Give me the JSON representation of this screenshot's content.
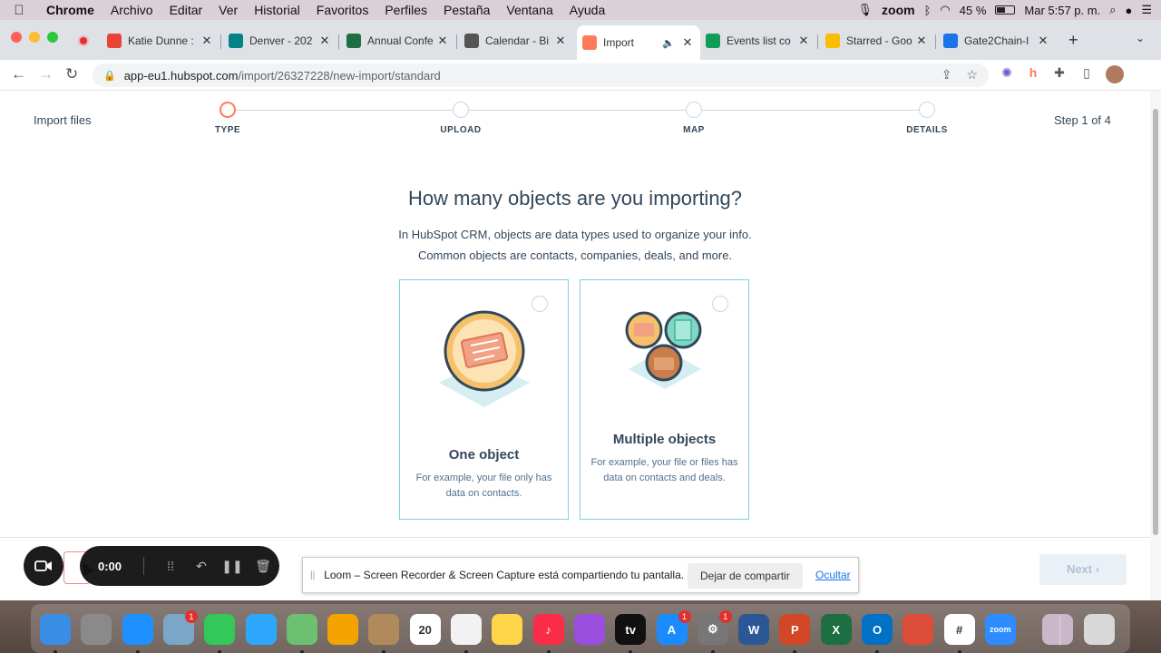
{
  "menubar": {
    "apple_icon": "",
    "items": [
      "Chrome",
      "Archivo",
      "Editar",
      "Ver",
      "Historial",
      "Favoritos",
      "Perfiles",
      "Pestaña",
      "Ventana",
      "Ayuda"
    ],
    "zoom_label": "zoom",
    "battery": "45 %",
    "clock": "Mar 5:57 p. m."
  },
  "browser": {
    "tabs": [
      {
        "title": "Katie Dunne :",
        "icon": "gmail-icon",
        "color": "#ea4335"
      },
      {
        "title": "Denver - 202",
        "icon": "sharepoint-icon",
        "color": "#038387"
      },
      {
        "title": "Annual Confe",
        "icon": "excel-icon",
        "color": "#1d6f42"
      },
      {
        "title": "Calendar - Bi",
        "icon": "calendar-icon",
        "color": "#555555"
      },
      {
        "title": "Import",
        "icon": "hubspot-icon",
        "color": "#ff7a59",
        "active": true
      },
      {
        "title": "Events list co",
        "icon": "sheets-icon",
        "color": "#0f9d58"
      },
      {
        "title": "Starred - Goo",
        "icon": "drive-icon",
        "color": "#fbbc04"
      },
      {
        "title": "Gate2Chain-I",
        "icon": "docs-icon",
        "color": "#1a73e8"
      }
    ],
    "url_host": "app-eu1.hubspot.com",
    "url_path": "/import/26327228/new-import/standard"
  },
  "page": {
    "import_label": "Import files",
    "step_indicator": "Step 1 of 4",
    "steps": [
      "TYPE",
      "UPLOAD",
      "MAP",
      "DETAILS"
    ],
    "current_step": 0,
    "question": "How many objects are you importing?",
    "description_line1": "In HubSpot CRM, objects are data types used to organize your info.",
    "description_line2": "Common objects are contacts, companies, deals, and more.",
    "options": [
      {
        "title": "One object",
        "description": "For example, your file only has data on contacts."
      },
      {
        "title": "Multiple objects",
        "description": "For example, your file or files has data on contacts and deals."
      }
    ],
    "next_label": "Next ›"
  },
  "loom": {
    "timer": "0:00",
    "share_message": "Loom – Screen Recorder & Screen Capture está compartiendo tu pantalla.",
    "stop_sharing": "Dejar de compartir",
    "hide": "Ocultar"
  },
  "dock": {
    "apps": [
      {
        "name": "finder",
        "color": "#3a8ee6",
        "label": ""
      },
      {
        "name": "launchpad",
        "color": "#8a8a8a",
        "label": ""
      },
      {
        "name": "safari",
        "color": "#1e90ff",
        "label": ""
      },
      {
        "name": "preview",
        "color": "#7aa7c7",
        "label": "",
        "badge": "1"
      },
      {
        "name": "facetime",
        "color": "#34c759",
        "label": ""
      },
      {
        "name": "messages",
        "color": "#2ea8ff",
        "label": ""
      },
      {
        "name": "maps",
        "color": "#6cc070",
        "label": ""
      },
      {
        "name": "photos",
        "color": "#f4a300",
        "label": ""
      },
      {
        "name": "contacts",
        "color": "#b08a5a",
        "label": ""
      },
      {
        "name": "calendar",
        "color": "#ffffff",
        "label": "20"
      },
      {
        "name": "reminders",
        "color": "#f2f2f2",
        "label": ""
      },
      {
        "name": "notes",
        "color": "#ffd54a",
        "label": ""
      },
      {
        "name": "music",
        "color": "#fa2d48",
        "label": "♪"
      },
      {
        "name": "podcasts",
        "color": "#9b4dde",
        "label": ""
      },
      {
        "name": "apple-tv",
        "color": "#111111",
        "label": "tv"
      },
      {
        "name": "app-store",
        "color": "#1a8cff",
        "label": "A",
        "badge": "1"
      },
      {
        "name": "system-preferences",
        "color": "#777777",
        "label": "⚙",
        "badge": "1"
      },
      {
        "name": "word",
        "color": "#2b5797",
        "label": "W"
      },
      {
        "name": "powerpoint",
        "color": "#d24726",
        "label": "P"
      },
      {
        "name": "excel",
        "color": "#1d6f42",
        "label": "X"
      },
      {
        "name": "outlook",
        "color": "#0072c6",
        "label": "O"
      },
      {
        "name": "chrome",
        "color": "#dd4b39",
        "label": ""
      },
      {
        "name": "slack",
        "color": "#ffffff",
        "label": "#"
      },
      {
        "name": "zoom",
        "color": "#2d8cff",
        "label": "zoom"
      },
      {
        "name": "downloads",
        "color": "#c9b8c8",
        "label": ""
      },
      {
        "name": "trash",
        "color": "#d8d8d8",
        "label": ""
      }
    ]
  }
}
